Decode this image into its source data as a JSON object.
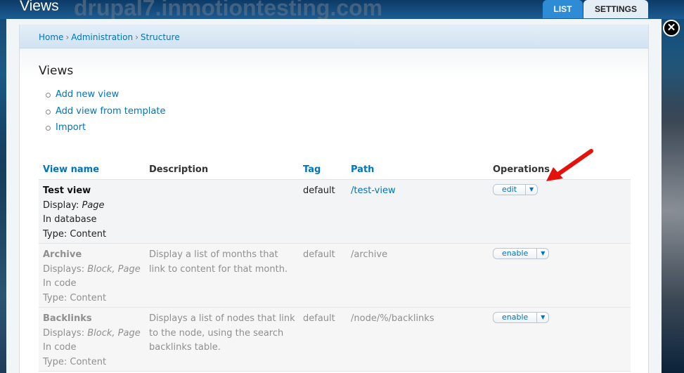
{
  "top": {
    "page_title": "Views",
    "site_name": "drupal7.inmotiontesting.com",
    "tabs": [
      "LIST",
      "SETTINGS"
    ],
    "close_glyph": "✕"
  },
  "breadcrumb": [
    "Home",
    "Administration",
    "Structure"
  ],
  "title": "Views",
  "actions": [
    "Add new view",
    "Add view from template",
    "Import"
  ],
  "table": {
    "headers": [
      "View name",
      "Description",
      "Tag",
      "Path",
      "Operations"
    ],
    "rows": [
      {
        "name": "Test view",
        "displays_label": "Display:",
        "displays": "Page",
        "storage": "In database",
        "type": "Type: Content",
        "description": "",
        "tag": "default",
        "path": "/test-view",
        "operation": "edit",
        "enabled": true
      },
      {
        "name": "Archive",
        "displays_label": "Displays:",
        "displays": "Block, Page",
        "storage": "In code",
        "type": "Type: Content",
        "description": "Display a list of months that link to content for that month.",
        "tag": "default",
        "path": "/archive",
        "operation": "enable",
        "enabled": false
      },
      {
        "name": "Backlinks",
        "displays_label": "Displays:",
        "displays": "Block, Page",
        "storage": "In code",
        "type": "Type: Content",
        "description": "Displays a list of nodes that link to the node, using the search backlinks table.",
        "tag": "default",
        "path": "/node/%/backlinks",
        "operation": "enable",
        "enabled": false
      }
    ]
  },
  "colors": {
    "link": "#0074bd",
    "tab_active": "#2e8bd5",
    "arrow": "#e3120b"
  },
  "icons": {
    "close": "close-icon",
    "caret": "caret-down-icon",
    "annotation": "red-arrow-annotation"
  }
}
